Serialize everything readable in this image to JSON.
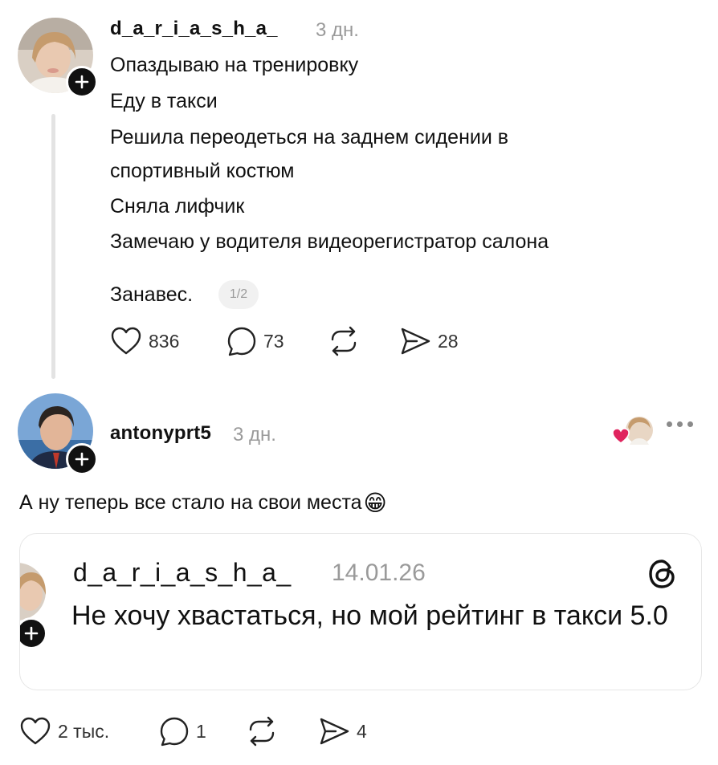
{
  "post": {
    "username": "d_a_r_i_a_s_h_a_",
    "time": "3 дн.",
    "lines": [
      "Опаздываю на тренировку",
      "Еду в такси",
      "Решила переодеться на заднем сидении в",
      "спортивный костюм",
      "Сняла лифчик",
      "Замечаю у водителя видеорегистратор салона"
    ],
    "last_line": "Занавес.",
    "page_indicator": "1/2",
    "likes": "836",
    "comments": "73",
    "shares": "28"
  },
  "reply": {
    "username": "antonyprt5",
    "time": "3 дн.",
    "text": "А ну теперь все стало на свои места",
    "emoji": "😁",
    "likes": "2 тыс.",
    "comments": "1",
    "shares": "4"
  },
  "quote": {
    "username": "d_a_r_i_a_s_h_a_",
    "time": "14.01.26",
    "text": "Не хочу хвастаться, но мой рейтинг в такси 5.0"
  },
  "colors": {
    "heart": "#e0245e",
    "muted": "#9a9a9a"
  }
}
